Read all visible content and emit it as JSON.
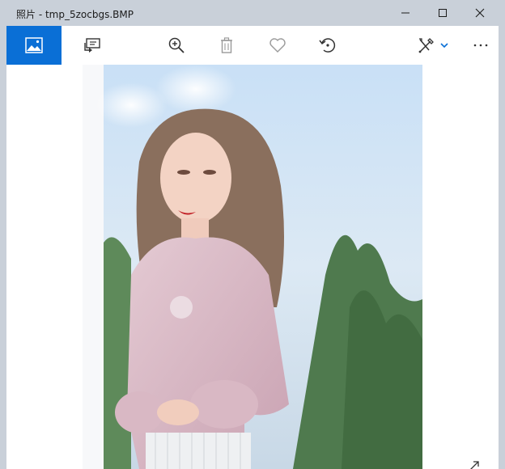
{
  "window": {
    "title": "照片 - tmp_5zocbgs.BMP",
    "controls": {
      "minimize": "minimize-icon",
      "maximize": "maximize-icon",
      "close": "close-icon"
    }
  },
  "toolbar": {
    "items": [
      {
        "icon": "photo-view-icon",
        "active": true
      },
      {
        "icon": "slideshow-icon"
      },
      {
        "icon": "zoom-in-icon"
      },
      {
        "icon": "delete-icon",
        "disabled": true
      },
      {
        "icon": "favorite-icon"
      },
      {
        "icon": "rotate-icon"
      },
      {
        "icon": "edit-create-icon",
        "has_dropdown": true
      },
      {
        "icon": "more-icon"
      }
    ]
  },
  "image": {
    "description_icon": "photo",
    "colors": {
      "sky": "#cde3f7",
      "blouse": "#d6b7c2",
      "foliage": "#4f7a4e",
      "hair": "#8a6f5d"
    }
  },
  "colors": {
    "titlebar": "#c9d0d9",
    "accent": "#0a6fd6",
    "background": "#ffffff"
  }
}
